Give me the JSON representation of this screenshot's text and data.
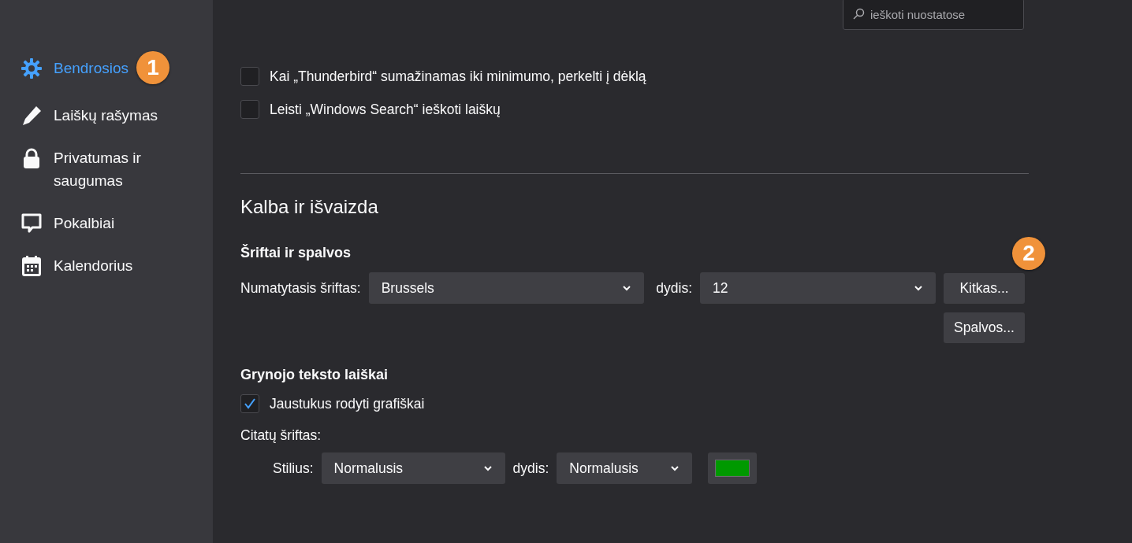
{
  "search": {
    "placeholder": "ieškoti nuostatose"
  },
  "sidebar": {
    "items": [
      {
        "label": "Bendrosios",
        "selected": true,
        "badge": "1"
      },
      {
        "label": "Laiškų rašymas",
        "selected": false
      },
      {
        "label": "Privatumas ir saugumas",
        "selected": false
      },
      {
        "label": "Pokalbiai",
        "selected": false
      },
      {
        "label": "Kalendorius",
        "selected": false
      }
    ]
  },
  "general_options": [
    {
      "label": "Kai „Thunderbird“ sumažinamas iki minimumo, perkelti į dėklą",
      "checked": false
    },
    {
      "label": "Leisti „Windows Search“ ieškoti laiškų",
      "checked": false
    }
  ],
  "section_title": "Kalba ir išvaizda",
  "fonts": {
    "title": "Šriftai ir spalvos",
    "badge": "2",
    "default_font_label": "Numatytasis šriftas:",
    "default_font": "Brussels",
    "size_label": "dydis:",
    "size": "12",
    "advanced_button": "Kitkas...",
    "colors_button": "Spalvos..."
  },
  "plain_text": {
    "title": "Grynojo teksto laiškai",
    "emoticons": {
      "label": "Jaustukus rodyti grafiškai",
      "checked": true
    },
    "quote_font_label": "Citatų šriftas:",
    "style_label": "Stilius:",
    "style": "Normalusis",
    "size_label": "dydis:",
    "size": "Normalusis"
  }
}
